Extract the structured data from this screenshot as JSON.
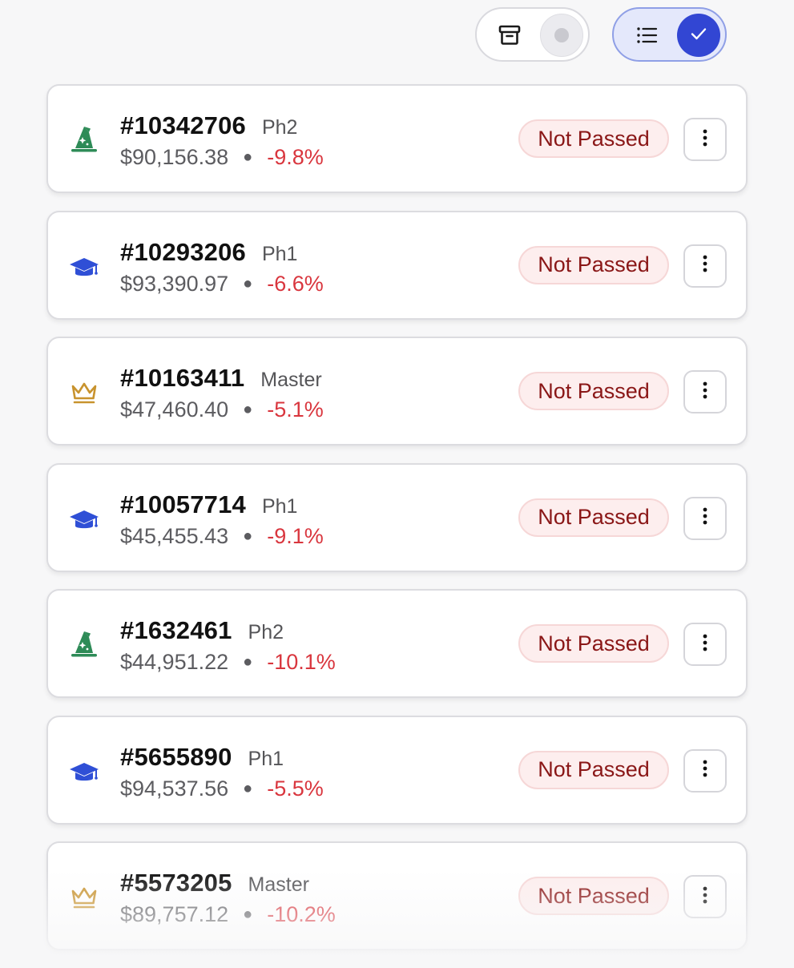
{
  "toolbar": {
    "archive_toggle": {
      "icon": "archive-icon",
      "state": "off"
    },
    "list_toggle": {
      "icon": "list-icon",
      "state": "on",
      "check_icon": "check-icon"
    }
  },
  "colors": {
    "accent": "#3246d3",
    "negative": "#d9363e",
    "badge_bg": "#fdeeee",
    "badge_text": "#8a1717",
    "wizard": "#2e8b57",
    "cap": "#2f4fd6",
    "crown": "#c8932e"
  },
  "accounts": [
    {
      "id": "#10342706",
      "phase": "Ph2",
      "balance": "$90,156.38",
      "change": "-9.8%",
      "status": "Not Passed",
      "icon": "wizard-hat-icon"
    },
    {
      "id": "#10293206",
      "phase": "Ph1",
      "balance": "$93,390.97",
      "change": "-6.6%",
      "status": "Not Passed",
      "icon": "graduation-cap-icon"
    },
    {
      "id": "#10163411",
      "phase": "Master",
      "balance": "$47,460.40",
      "change": "-5.1%",
      "status": "Not Passed",
      "icon": "crown-icon"
    },
    {
      "id": "#10057714",
      "phase": "Ph1",
      "balance": "$45,455.43",
      "change": "-9.1%",
      "status": "Not Passed",
      "icon": "graduation-cap-icon"
    },
    {
      "id": "#1632461",
      "phase": "Ph2",
      "balance": "$44,951.22",
      "change": "-10.1%",
      "status": "Not Passed",
      "icon": "wizard-hat-icon"
    },
    {
      "id": "#5655890",
      "phase": "Ph1",
      "balance": "$94,537.56",
      "change": "-5.5%",
      "status": "Not Passed",
      "icon": "graduation-cap-icon"
    },
    {
      "id": "#5573205",
      "phase": "Master",
      "balance": "$89,757.12",
      "change": "-10.2%",
      "status": "Not Passed",
      "icon": "crown-icon"
    }
  ]
}
